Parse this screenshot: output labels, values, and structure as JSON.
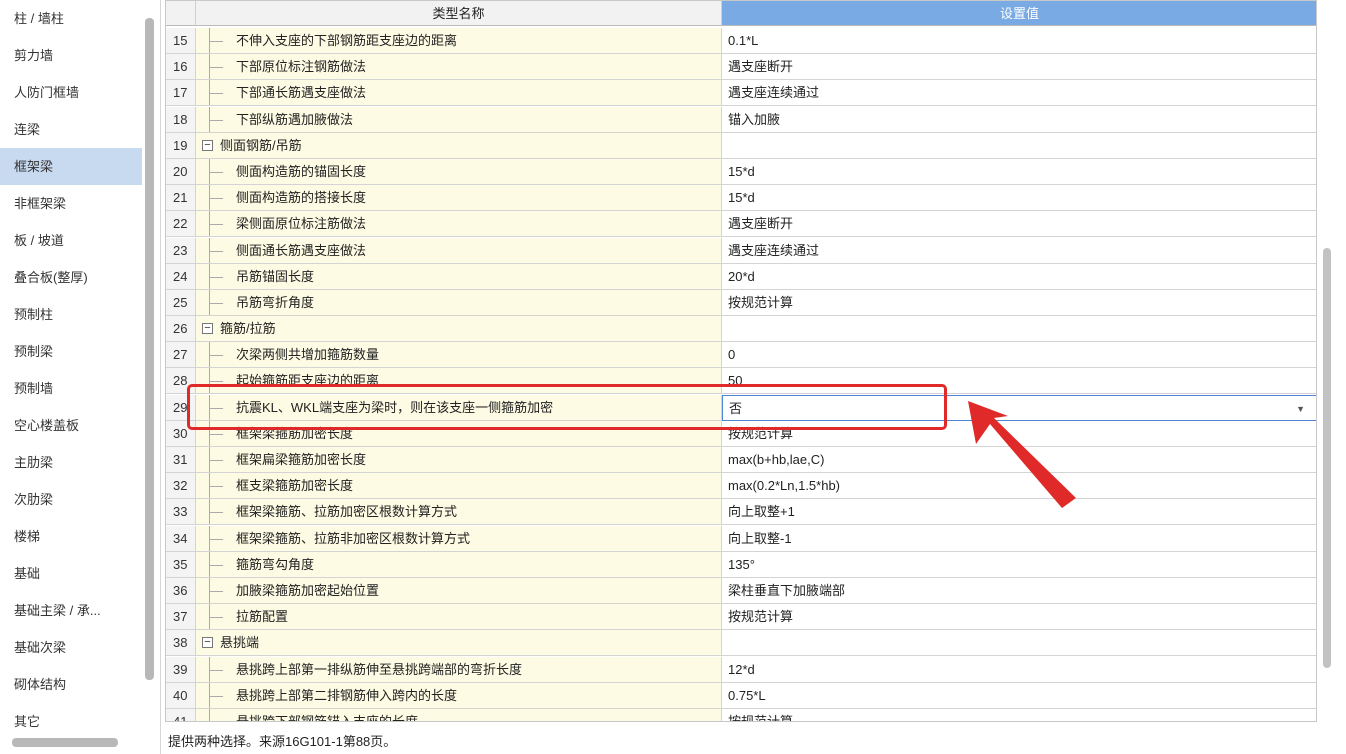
{
  "sidebar": {
    "items": [
      {
        "label": "柱 / 墙柱"
      },
      {
        "label": "剪力墙"
      },
      {
        "label": "人防门框墙"
      },
      {
        "label": "连梁"
      },
      {
        "label": "框架梁",
        "selected": true
      },
      {
        "label": "非框架梁"
      },
      {
        "label": "板 / 坡道"
      },
      {
        "label": "叠合板(整厚)"
      },
      {
        "label": "预制柱"
      },
      {
        "label": "预制梁"
      },
      {
        "label": "预制墙"
      },
      {
        "label": "空心楼盖板"
      },
      {
        "label": "主肋梁"
      },
      {
        "label": "次肋梁"
      },
      {
        "label": "楼梯"
      },
      {
        "label": "基础"
      },
      {
        "label": "基础主梁 / 承..."
      },
      {
        "label": "基础次梁"
      },
      {
        "label": "砌体结构"
      },
      {
        "label": "其它"
      }
    ]
  },
  "grid": {
    "header": {
      "name": "类型名称",
      "value": "设置值"
    },
    "rows": [
      {
        "num": "15",
        "type": "leaf",
        "name": "不伸入支座的下部钢筋距支座边的距离",
        "value": "0.1*L"
      },
      {
        "num": "16",
        "type": "leaf",
        "name": "下部原位标注钢筋做法",
        "value": "遇支座断开"
      },
      {
        "num": "17",
        "type": "leaf",
        "name": "下部通长筋遇支座做法",
        "value": "遇支座连续通过"
      },
      {
        "num": "18",
        "type": "leaf",
        "name": "下部纵筋遇加腋做法",
        "value": "锚入加腋"
      },
      {
        "num": "19",
        "type": "group",
        "name": "侧面钢筋/吊筋",
        "value": ""
      },
      {
        "num": "20",
        "type": "leaf",
        "name": "侧面构造筋的锚固长度",
        "value": "15*d"
      },
      {
        "num": "21",
        "type": "leaf",
        "name": "侧面构造筋的搭接长度",
        "value": "15*d"
      },
      {
        "num": "22",
        "type": "leaf",
        "name": "梁侧面原位标注筋做法",
        "value": "遇支座断开"
      },
      {
        "num": "23",
        "type": "leaf",
        "name": "侧面通长筋遇支座做法",
        "value": "遇支座连续通过"
      },
      {
        "num": "24",
        "type": "leaf",
        "name": "吊筋锚固长度",
        "value": "20*d"
      },
      {
        "num": "25",
        "type": "leaf",
        "name": "吊筋弯折角度",
        "value": "按规范计算"
      },
      {
        "num": "26",
        "type": "group",
        "name": "箍筋/拉筋",
        "value": ""
      },
      {
        "num": "27",
        "type": "leaf",
        "name": "次梁两侧共增加箍筋数量",
        "value": "0"
      },
      {
        "num": "28",
        "type": "leaf",
        "name": "起始箍筋距支座边的距离",
        "value": "50"
      },
      {
        "num": "29",
        "type": "leaf",
        "name": "抗震KL、WKL端支座为梁时，则在该支座一侧箍筋加密",
        "value": "否",
        "editing": true
      },
      {
        "num": "30",
        "type": "leaf",
        "name": "框架梁箍筋加密长度",
        "value": "按规范计算"
      },
      {
        "num": "31",
        "type": "leaf",
        "name": "框架扁梁箍筋加密长度",
        "value": "max(b+hb,lae,C)"
      },
      {
        "num": "32",
        "type": "leaf",
        "name": "框支梁箍筋加密长度",
        "value": "max(0.2*Ln,1.5*hb)"
      },
      {
        "num": "33",
        "type": "leaf",
        "name": "框架梁箍筋、拉筋加密区根数计算方式",
        "value": "向上取整+1"
      },
      {
        "num": "34",
        "type": "leaf",
        "name": "框架梁箍筋、拉筋非加密区根数计算方式",
        "value": "向上取整-1"
      },
      {
        "num": "35",
        "type": "leaf",
        "name": "箍筋弯勾角度",
        "value": "135°"
      },
      {
        "num": "36",
        "type": "leaf",
        "name": "加腋梁箍筋加密起始位置",
        "value": "梁柱垂直下加腋端部"
      },
      {
        "num": "37",
        "type": "leaf",
        "name": "拉筋配置",
        "value": "按规范计算"
      },
      {
        "num": "38",
        "type": "group",
        "name": "悬挑端",
        "value": ""
      },
      {
        "num": "39",
        "type": "leaf",
        "name": "悬挑跨上部第一排纵筋伸至悬挑跨端部的弯折长度",
        "value": "12*d"
      },
      {
        "num": "40",
        "type": "leaf",
        "name": "悬挑跨上部第二排钢筋伸入跨内的长度",
        "value": "0.75*L"
      },
      {
        "num": "41",
        "type": "leaf",
        "name": "悬挑跨下部钢筋锚入支座的长度",
        "value": "按规范计算"
      }
    ]
  },
  "status": {
    "text": "提供两种选择。来源16G101-1第88页。"
  },
  "annotation": {
    "color": "#e02a2a"
  },
  "icons": {
    "expander": "minus-box-icon",
    "dropdown": "chevron-down-icon"
  }
}
